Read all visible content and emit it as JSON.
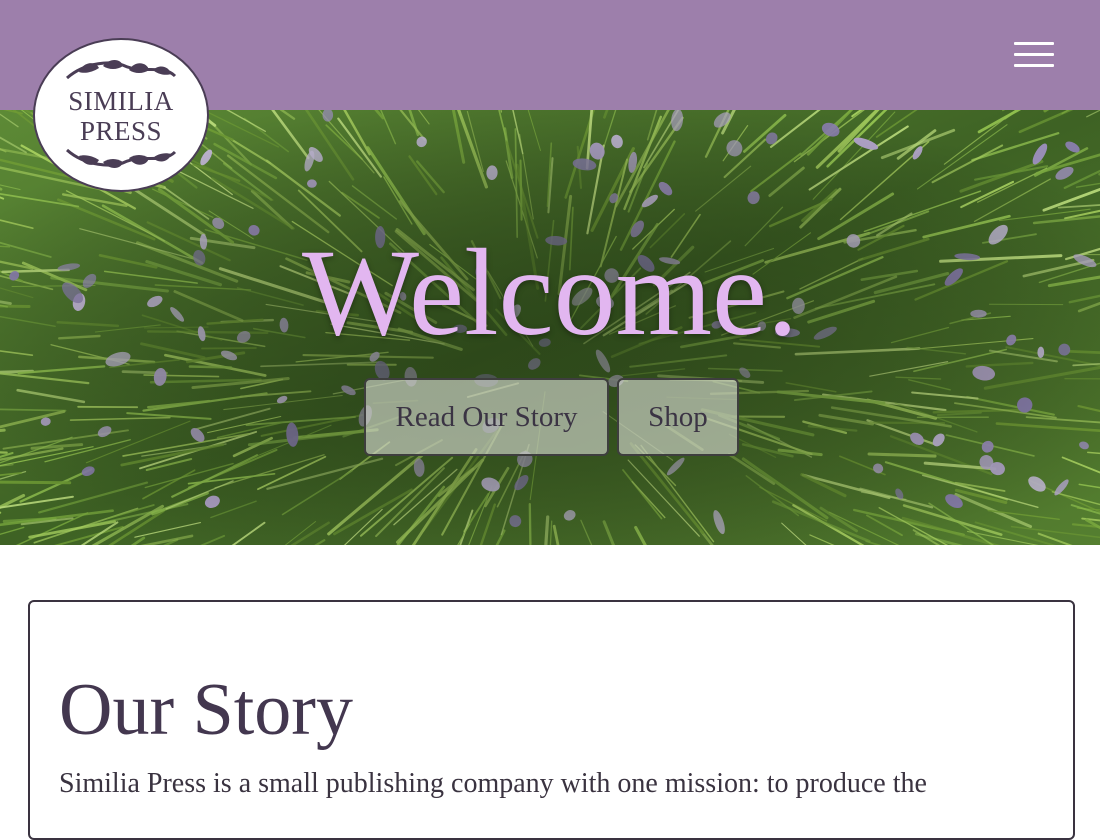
{
  "header": {
    "background_color": "#9d7fab",
    "logo": {
      "line1": "SIMILIA",
      "line2": "PRESS"
    },
    "menu_icon": "hamburger-menu-icon"
  },
  "hero": {
    "background_image": "lavender-field-photo",
    "title": "Welcome.",
    "title_color": "#e2b6f0",
    "buttons": {
      "story_label": "Read Our Story",
      "shop_label": "Shop"
    }
  },
  "story": {
    "heading": "Our Story",
    "text": "Similia Press is a small publishing company with one mission: to produce the"
  }
}
